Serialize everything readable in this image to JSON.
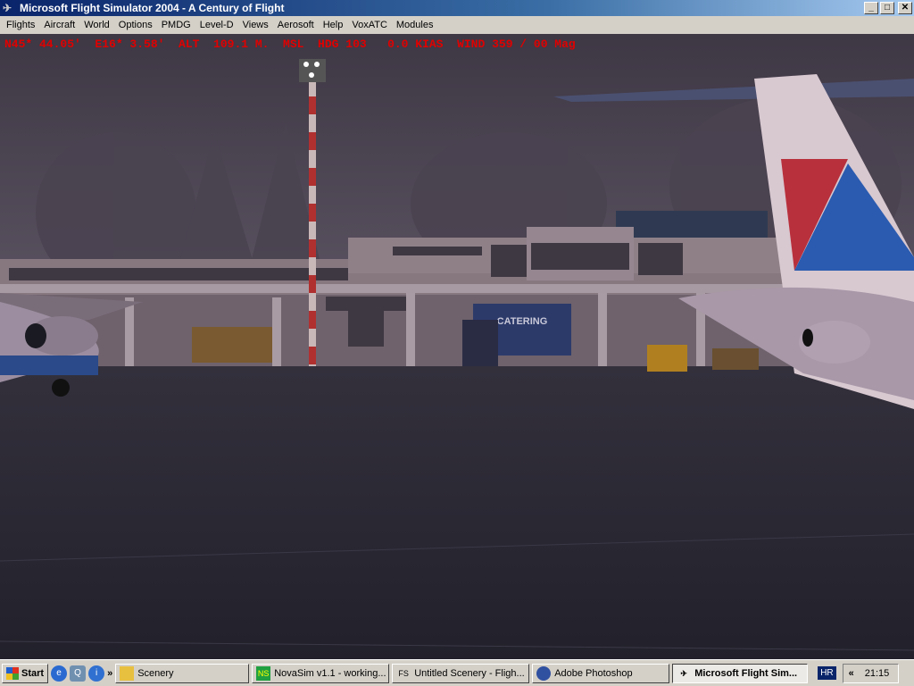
{
  "window": {
    "title": "Microsoft Flight Simulator 2004 - A Century of Flight",
    "minimize": "_",
    "maximize": "□",
    "close": "✕"
  },
  "menu": [
    "Flights",
    "Aircraft",
    "World",
    "Options",
    "PMDG",
    "Level-D",
    "Views",
    "Aerosoft",
    "Help",
    "VoxATC",
    "Modules"
  ],
  "hud": {
    "text": "N45* 44.05'  E16* 3.58'  ALT  109.1 M.  MSL  HDG 103   0.0 KIAS  WIND 359 / 00 Mag",
    "color": "#e00000"
  },
  "scene": {
    "truck_label": "CATERING"
  },
  "taskbar": {
    "start": "Start",
    "chevron": "»",
    "tasks": [
      {
        "label": "Scenery",
        "icon": "folder-icon"
      },
      {
        "label": "NovaSim v1.1 - working...",
        "icon": "novasim-icon"
      },
      {
        "label": "Untitled Scenery - Fligh...",
        "icon": "fs-sdk-icon"
      },
      {
        "label": "Adobe Photoshop",
        "icon": "photoshop-icon"
      },
      {
        "label": "Microsoft Flight Sim...",
        "icon": "airplane-icon",
        "active": true
      }
    ],
    "language": "HR",
    "tray_expand": "«",
    "clock": "21:15"
  }
}
